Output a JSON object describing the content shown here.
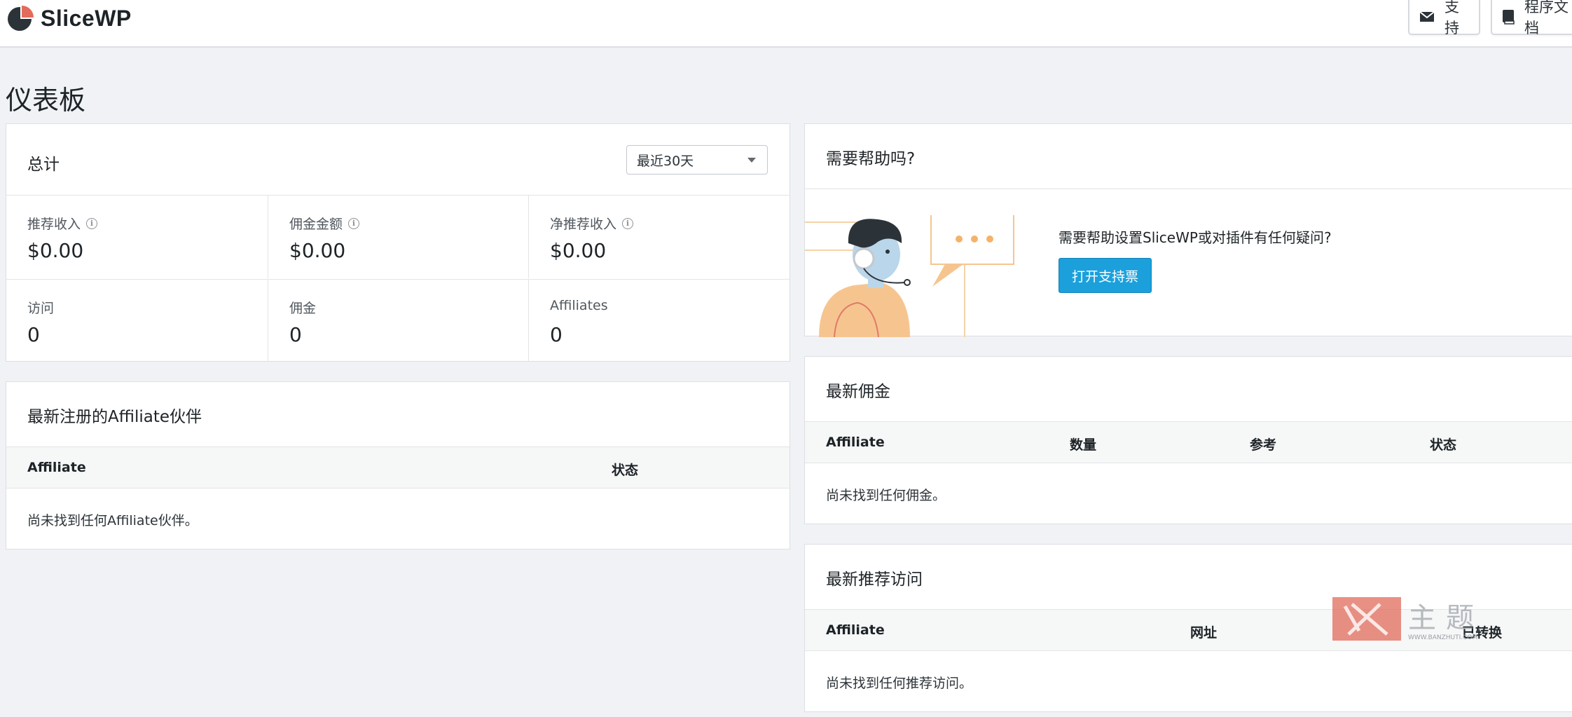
{
  "app": {
    "name": "SliceWP"
  },
  "header": {
    "support_label": "支持",
    "docs_label": "程序文档"
  },
  "page": {
    "title": "仪表板"
  },
  "totals": {
    "title": "总计",
    "period": "最近30天",
    "stats": [
      {
        "label": "推荐收入",
        "value": "$0.00",
        "info": true
      },
      {
        "label": "佣金金额",
        "value": "$0.00",
        "info": true
      },
      {
        "label": "净推荐收入",
        "value": "$0.00",
        "info": true
      },
      {
        "label": "访问",
        "value": "0",
        "info": false
      },
      {
        "label": "佣金",
        "value": "0",
        "info": false
      },
      {
        "label": "Affiliates",
        "value": "0",
        "info": false
      }
    ]
  },
  "latest_affiliates": {
    "title": "最新注册的Affiliate伙伴",
    "columns": [
      "Affiliate",
      "状态"
    ],
    "empty": "尚未找到任何Affiliate伙伴。"
  },
  "help": {
    "title": "需要帮助吗?",
    "question": "需要帮助设置SliceWP或对插件有任何疑问?",
    "button": "打开支持票"
  },
  "latest_commissions": {
    "title": "最新佣金",
    "columns": [
      "Affiliate",
      "数量",
      "参考",
      "状态"
    ],
    "empty": "尚未找到任何佣金。"
  },
  "latest_visits": {
    "title": "最新推荐访问",
    "columns": [
      "Affiliate",
      "网址",
      "已转换"
    ],
    "empty": "尚未找到任何推荐访问。"
  },
  "watermark": {
    "text": "主题",
    "url": "WWW.BANZHUTI.COM"
  },
  "colors": {
    "accent": "#1ba0dc",
    "logo": "#e26b5b",
    "background": "#f0f2f5"
  }
}
